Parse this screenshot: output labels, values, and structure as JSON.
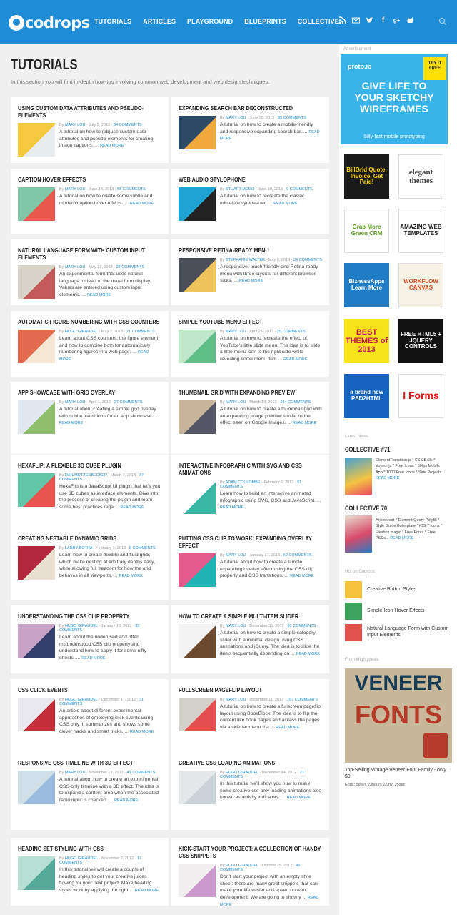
{
  "header": {
    "logo": "codrops",
    "nav": [
      "TUTORIALS",
      "ARTICLES",
      "PLAYGROUND",
      "BLUEPRINTS",
      "COLLECTIVE"
    ]
  },
  "page": {
    "title": "TUTORIALS",
    "intro": "In this section you will find in-depth how-tos involving common web development and web design techniques."
  },
  "meta": {
    "by": "By",
    "read_more": "READ MORE"
  },
  "tutorials": [
    {
      "title": "Using Custom Data Attributes and Pseudo-Elements",
      "author": "MARY LOU",
      "date": "July 5, 2013",
      "comments": "34 COMMENTS",
      "text": "A tutorial on how to (ab)use custom data attributes and pseudo-elements for creating image captions. ..."
    },
    {
      "title": "Expanding Search Bar Deconstructed",
      "author": "MARY LOU",
      "date": "June 26, 2013",
      "comments": "35 COMMENTS",
      "text": "A tutorial on how to create a mobile-friendly and responsive expanding search bar. ..."
    },
    {
      "title": "Caption Hover Effects",
      "author": "MARY LOU",
      "date": "June 18, 2013",
      "comments": "55 COMMENTS",
      "text": "A tutorial on how to create some subtle and modern caption hover effects. ..."
    },
    {
      "title": "Web Audio Stylophone",
      "author": "STUART MEMO",
      "date": "June 10, 2013",
      "comments": "9 COMMENTS",
      "text": "A tutorial on how to recreate the classic miniature synthesizer. ..."
    },
    {
      "title": "Natural Language Form with Custom Input Elements",
      "author": "MARY LOU",
      "date": "May 21, 2013",
      "comments": "28 COMMENTS",
      "text": "An experimental form that uses natural language instead of the usual form display. Values are entered using custom input elements. ..."
    },
    {
      "title": "Responsive Retina-Ready Menu",
      "author": "STEPHANIE WALTER",
      "date": "May 8, 2013",
      "comments": "59 COMMENTS",
      "text": "A responsive, touch-friendly and Retina-ready menu with three layouts for different browser sizes. ..."
    },
    {
      "title": "Automatic Figure Numbering with CSS Counters",
      "author": "HUGO GIRAUDEL",
      "date": "May 2, 2013",
      "comments": "21 COMMENTS",
      "text": "Learn about CSS counters, the figure element and how to combine both for automatically numbering figures in a web page. ..."
    },
    {
      "title": "Simple YouTube Menu Effect",
      "author": "MARY LOU",
      "date": "April 25, 2013",
      "comments": "25 COMMENTS",
      "text": "A tutorial on how to recreate the effect of YouTube's little slide menu. The idea is to slide a little menu icon to the right side while revealing some menu item ..."
    },
    {
      "title": "App Showcase with Grid Overlay",
      "author": "MARY LOU",
      "date": "April 1, 2013",
      "comments": "27 COMMENTS",
      "text": "A tutorial about creating a simple grid overlay with subtle transitions for an app showcase. ..."
    },
    {
      "title": "Thumbnail Grid with Expanding Preview",
      "author": "MARY LOU",
      "date": "March 19, 2013",
      "comments": "244 COMMENTS",
      "text": "A tutorial on how to create a thumbnail grid with an expanding image preview similar to the effect seen on Google Images. ..."
    },
    {
      "title": "HexaFlip: A Flexible 3D Cube Plugin",
      "author": "DAN MOTZENBECKER",
      "date": "March 7, 2013",
      "comments": "47 COMMENTS",
      "text": "HexaFlip is a JavaScript UI plugin that let's you use 3D cubes as interface elements. Dive into the process of creating the plugin and learn some best practices rega ..."
    },
    {
      "title": "Interactive Infographic with SVG and CSS Animations",
      "author": "ADAM COULOMBE",
      "date": "February 6, 2013",
      "comments": "51 COMMENTS",
      "text": "Learn how to build an interactive animated infographic using SVG, CSS and JavaScript. ..."
    },
    {
      "title": "Creating Nestable Dynamic Grids",
      "author": "LARRY BOTHA",
      "date": "February 4, 2013",
      "comments": "8 COMMENTS",
      "text": "Learn how to create flexible and fluid grids which make nesting at arbitrary depths easy, while allowing full freedom for how the grid behaves in all viewports. ..."
    },
    {
      "title": "Putting CSS Clip to Work: Expanding Overlay Effect",
      "author": "MARY LOU",
      "date": "January 17, 2013",
      "comments": "62 COMMENTS",
      "text": "A tutorial about how to create a simple expanding overlay effect using the CSS clip property and CSS transitions. ..."
    },
    {
      "title": "Understanding the CSS Clip Property",
      "author": "HUGO GIRAUDEL",
      "date": "January 16, 2013",
      "comments": "33 COMMENTS",
      "text": "Learn about the underused and often misunderstood CSS clip property and understand how to apply it for some nifty effects. ..."
    },
    {
      "title": "How to Create a Simple Multi-Item Slider",
      "author": "MARY LOU",
      "date": "December 31, 2012",
      "comments": "91 COMMENTS",
      "text": "A tutorial on how to create a simple category slider with a minimal design using CSS animations and jQuery. The idea is to slide the items sequentially depending on ..."
    },
    {
      "title": "CSS Click Events",
      "author": "HUGO GIRAUDEL",
      "date": "December 17, 2012",
      "comments": "31 COMMENTS",
      "text": "An article about different experimental approaches of employing click events using CSS only. It summarizes and shows some clever hacks and smart tricks. ..."
    },
    {
      "title": "Fullscreen Pageflip Layout",
      "author": "MARY LOU",
      "date": "December 11, 2012",
      "comments": "107 COMMENTS",
      "text": "A tutorial on how to create a fullscreen pageflip layout using BookBlock. The idea is to flip the content like book pages and access the pages via a sidebar menu tha ..."
    },
    {
      "title": "Responsive CSS Timeline with 3D Effect",
      "author": "MARY LOU",
      "date": "November 19, 2012",
      "comments": "41 COMMENTS",
      "text": "A tutorial about how to create an experimental CSS-only timeline with a 3D effect. The idea is to expand a content area when the associated radio input is checked. ..."
    },
    {
      "title": "Creative CSS Loading Animations",
      "author": "HUGO GIRAUDEL",
      "date": "November 14, 2012",
      "comments": "21 COMMENTS",
      "text": "In this tutorial we'll show you how to make some creative css-only loading animations also known as activity indicators. ..."
    },
    {
      "title": "Heading Set Styling with CSS",
      "author": "HUGO GIRAUDEL",
      "date": "November 2, 2012",
      "comments": "17 COMMENTS",
      "text": "In this tutorial we will create a couple of heading styles to get your creative juices flowing for your next project. Make heading styles work by applying the right ..."
    },
    {
      "title": "Kick-Start Your Project: A Collection of Handy CSS Snippets",
      "author": "HUGO GIRAUDEL",
      "date": "October 25, 2012",
      "comments": "45 COMMENTS",
      "text": "Don't start your project with an empty style sheet: there are many great snippets that can make your life easier and speed up web development. We are going to show y ..."
    }
  ],
  "sidebar": {
    "ad_label": "Advertisement",
    "proto": {
      "brand": "proto.io",
      "badge": "TRY IT FREE",
      "headline": "GIVE LIFE TO YOUR SKETCHY WIREFRAMES",
      "sub": "Silly-fast mobile prototyping"
    },
    "small_ads": [
      "BillGrid Quote, Invoice, Get Paid!",
      "elegant themes",
      "Grab More Green CRM",
      "AMAZING WEB TEMPLATES",
      "BiznessApps Learn More",
      "WORKFLOW CANVAS",
      "BEST THEMES of 2013",
      "FREE HTML5 + JQUERY CONTROLS",
      "a brand new PSD2HTML",
      "I Forms"
    ],
    "latest_label": "Latest News:",
    "news": [
      {
        "title": "COLLECTIVE #71",
        "text": "ElementTransition.js * CSS Balls * Voyeur.js * Free Icons * 60fps Mobile App * 1000 Free Icons * Side Projects..."
      },
      {
        "title": "COLLECTIVE 70",
        "text": "Aristochart * Element Query Polyfill * Style Guide Boilerplate * iOS 7 Icons * Flexbox magic * Free Fonts * Free PSDs..."
      }
    ],
    "hot_label": "Hot on Codrops:",
    "hot": [
      "Creative Button Styles",
      "Simple Icon Hover Effects",
      "Natural Language Form with Custom Input Elements"
    ],
    "mighty_label": "From Mightydeals",
    "deal": {
      "headline_top": "VENEER",
      "headline_mid": "FONTS",
      "title": "Top-Selling Vintage Veneer Font Family - only $9!",
      "ends_label": "Ends:",
      "ends": "5days 23hours 12min 25sec"
    }
  }
}
